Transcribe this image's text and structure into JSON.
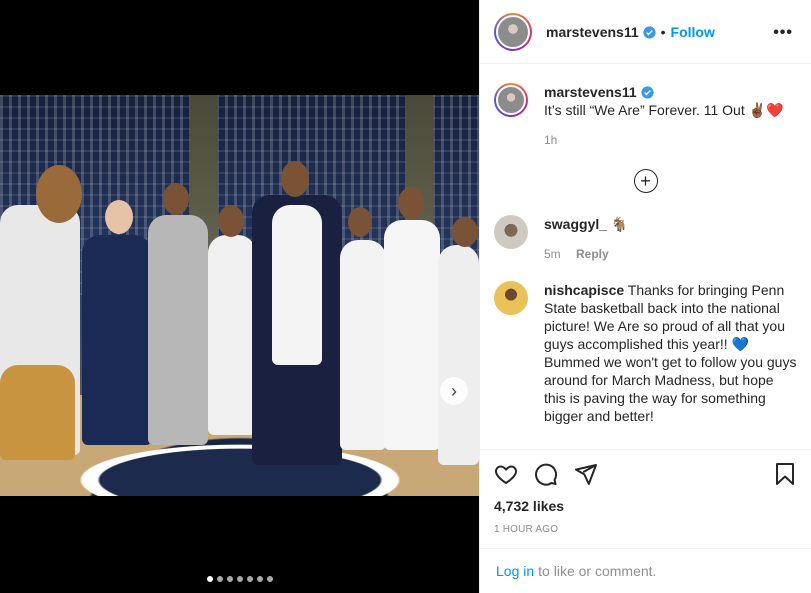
{
  "post": {
    "username": "marstevens11",
    "separator": "•",
    "follow_label": "Follow",
    "more_label": "•••",
    "image_alt": "Group photo on basketball court with Penn State mascot",
    "carousel": {
      "total_slides": 7,
      "active_slide": 1
    },
    "caption": {
      "username": "marstevens11",
      "text": "It’s still “We Are” Forever. 11 Out ✌🏾❤️",
      "time": "1h"
    },
    "load_more_label": "+",
    "comments": [
      {
        "username": "swaggyl_",
        "text": "🐐",
        "time": "5m",
        "reply_label": "Reply"
      },
      {
        "username": "nishcapisce",
        "text": "Thanks for bringing Penn State basketball back into the national picture! We Are so proud of all that you guys accomplished this year!! 💙 Bummed we won't get to follow you guys around for March Madness, but hope this is paving the way for something bigger and better!"
      }
    ],
    "likes": "4,732 likes",
    "posted_ago": "1 HOUR AGO",
    "login": {
      "link": "Log in",
      "rest": "to like or comment."
    }
  },
  "icons": [
    "verified-badge-icon",
    "more-options-icon",
    "heart-icon",
    "comment-icon",
    "share-icon",
    "bookmark-icon",
    "chevron-right-icon",
    "load-more-icon"
  ],
  "colors": {
    "link_blue": "#0095f6",
    "text": "#262626",
    "muted": "#8e8e8e",
    "border": "#efefef"
  }
}
